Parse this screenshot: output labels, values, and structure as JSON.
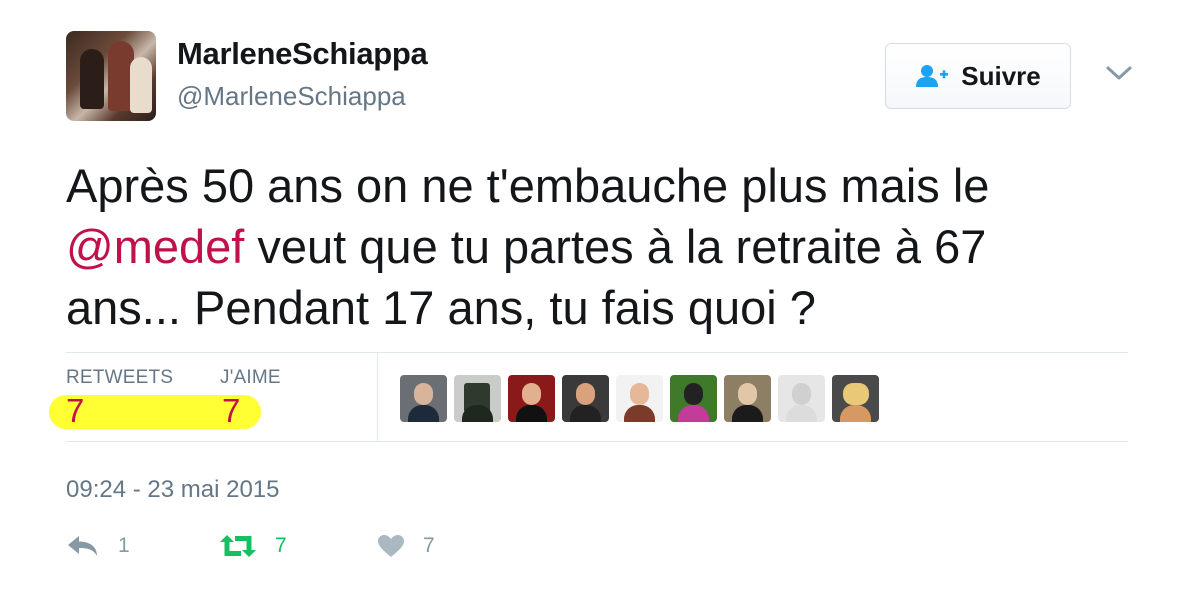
{
  "user": {
    "display_name": "MarleneSchiappa",
    "handle": "@MarleneSchiappa"
  },
  "follow_button": {
    "label": "Suivre",
    "icon": "follow-user-icon"
  },
  "menu": {
    "icon": "chevron-down-icon"
  },
  "tweet": {
    "line1": "Après 50 ans on ne t'embauche plus mais le",
    "mention": "@medef",
    "line2_rest": " veut que tu partes à la retraite à 67",
    "line3": "ans... Pendant 17 ans, tu fais quoi ?"
  },
  "stats": {
    "retweets_label": "RETWEETS",
    "retweets_value": "7",
    "likes_label": "J'AIME",
    "likes_value": "7",
    "highlight_color": "#ffff33"
  },
  "likers_count": 9,
  "timestamp": "09:24 - 23 mai 2015",
  "actions": {
    "reply_count": "1",
    "retweet_count": "7",
    "like_count": "7"
  },
  "colors": {
    "mention": "#c0124a",
    "retweet_green": "#17bf63",
    "secondary": "#657786",
    "follow_icon": "#1da1f2"
  }
}
